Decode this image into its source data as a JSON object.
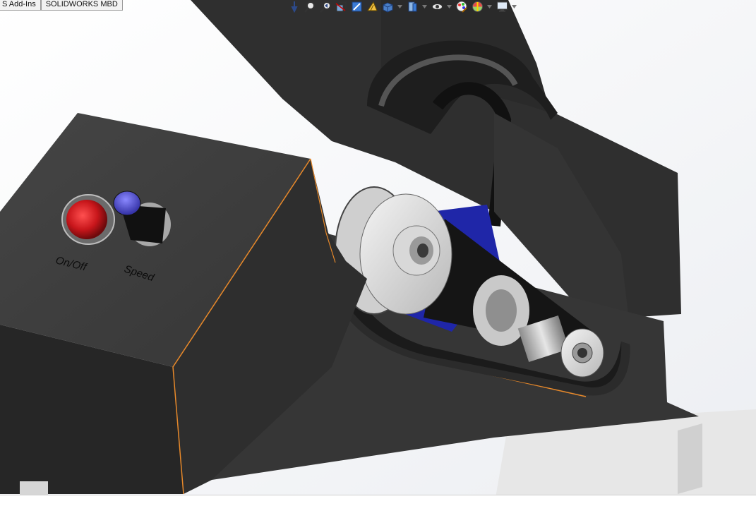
{
  "command_manager": {
    "tabs": [
      {
        "label": "S Add-Ins"
      },
      {
        "label": "SOLIDWORKS MBD"
      }
    ]
  },
  "heads_up_toolbar": {
    "buttons": [
      {
        "icon": "zoom-to-fit-icon"
      },
      {
        "icon": "zoom-to-area-icon"
      },
      {
        "icon": "previous-view-icon"
      },
      {
        "icon": "section-view-icon"
      },
      {
        "icon": "dynamic-annotation-icon"
      },
      {
        "icon": "view-orientation-icon"
      },
      {
        "icon": "display-style-icon"
      },
      {
        "icon": "hide-show-items-icon"
      },
      {
        "icon": "edit-appearance-icon"
      },
      {
        "icon": "apply-scene-icon"
      },
      {
        "icon": "view-settings-icon"
      }
    ]
  },
  "model": {
    "control_panel": {
      "power_switch_label": "On/Off",
      "speed_knob_label": "Speed"
    },
    "colors": {
      "housing": "#3b3b3b",
      "housing_dark": "#262626",
      "edge_highlight": "#e8892a",
      "switch_red": "#c8161b",
      "knob_blue": "#4a48c8",
      "motor_blue": "#1f26a8",
      "pulley_gray": "#d4d4d4",
      "background_top": "#f7f8fa"
    }
  }
}
